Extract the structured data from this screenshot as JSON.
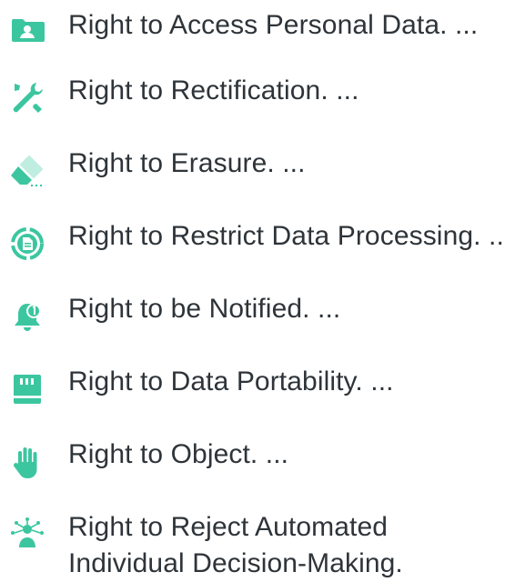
{
  "accent": "#3cc6a0",
  "items": [
    {
      "label": "Right to Access Personal Data. ...",
      "icon": "person-folder-icon"
    },
    {
      "label": "Right to Rectification. ...",
      "icon": "tools-icon"
    },
    {
      "label": "Right to Erasure. ...",
      "icon": "eraser-icon"
    },
    {
      "label": "Right to Restrict Data Processing. ...",
      "icon": "restrict-document-icon"
    },
    {
      "label": "Right to be Notified. ...",
      "icon": "notification-bell-icon"
    },
    {
      "label": "Right to Data Portability. ...",
      "icon": "sd-card-icon"
    },
    {
      "label": "Right to Object. ...",
      "icon": "hand-icon"
    },
    {
      "label": "Right to Reject Automated Individual Decision-Making.",
      "icon": "automation-person-icon"
    }
  ]
}
